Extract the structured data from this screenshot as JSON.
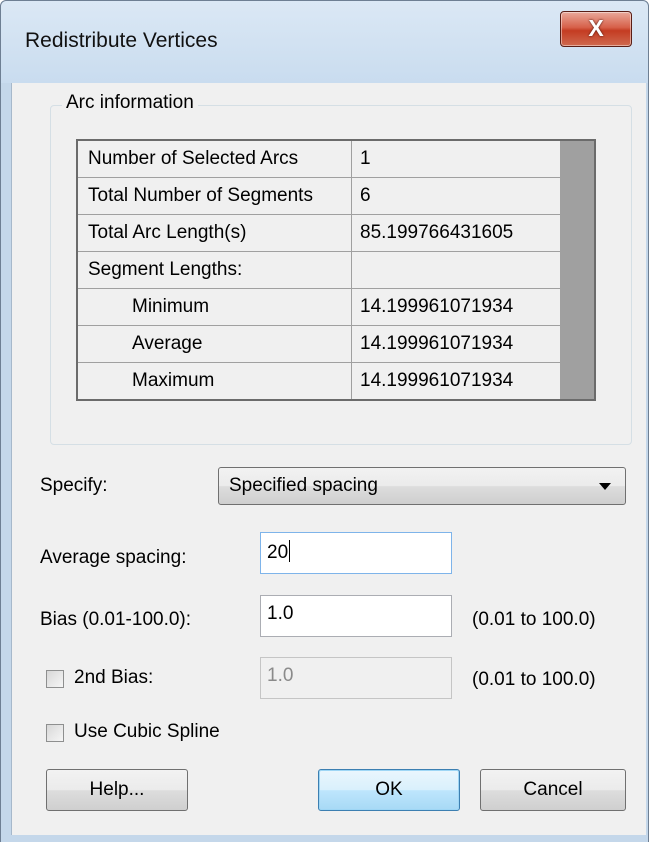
{
  "window": {
    "title": "Redistribute Vertices",
    "close_label": "X"
  },
  "arc_info": {
    "group_label": "Arc information",
    "rows": [
      {
        "label": "Number of Selected Arcs",
        "value": "1"
      },
      {
        "label": "Total Number of Segments",
        "value": "6"
      },
      {
        "label": "Total Arc Length(s)",
        "value": "85.199766431605"
      },
      {
        "label": "Segment Lengths:",
        "value": ""
      },
      {
        "label": "Minimum",
        "value": "14.199961071934"
      },
      {
        "label": "Average",
        "value": "14.199961071934"
      },
      {
        "label": "Maximum",
        "value": "14.199961071934"
      }
    ]
  },
  "specify": {
    "label": "Specify:",
    "selected": "Specified spacing"
  },
  "average_spacing": {
    "label": "Average spacing:",
    "value": "20"
  },
  "bias": {
    "label": "Bias (0.01-100.0):",
    "value": "1.0",
    "range": "(0.01 to 100.0)"
  },
  "second_bias": {
    "label": "2nd Bias:",
    "value": "1.0",
    "range": "(0.01 to 100.0)",
    "checked": false
  },
  "cubic_spline": {
    "label": "Use Cubic Spline",
    "checked": false
  },
  "buttons": {
    "help": "Help...",
    "ok": "OK",
    "cancel": "Cancel"
  }
}
